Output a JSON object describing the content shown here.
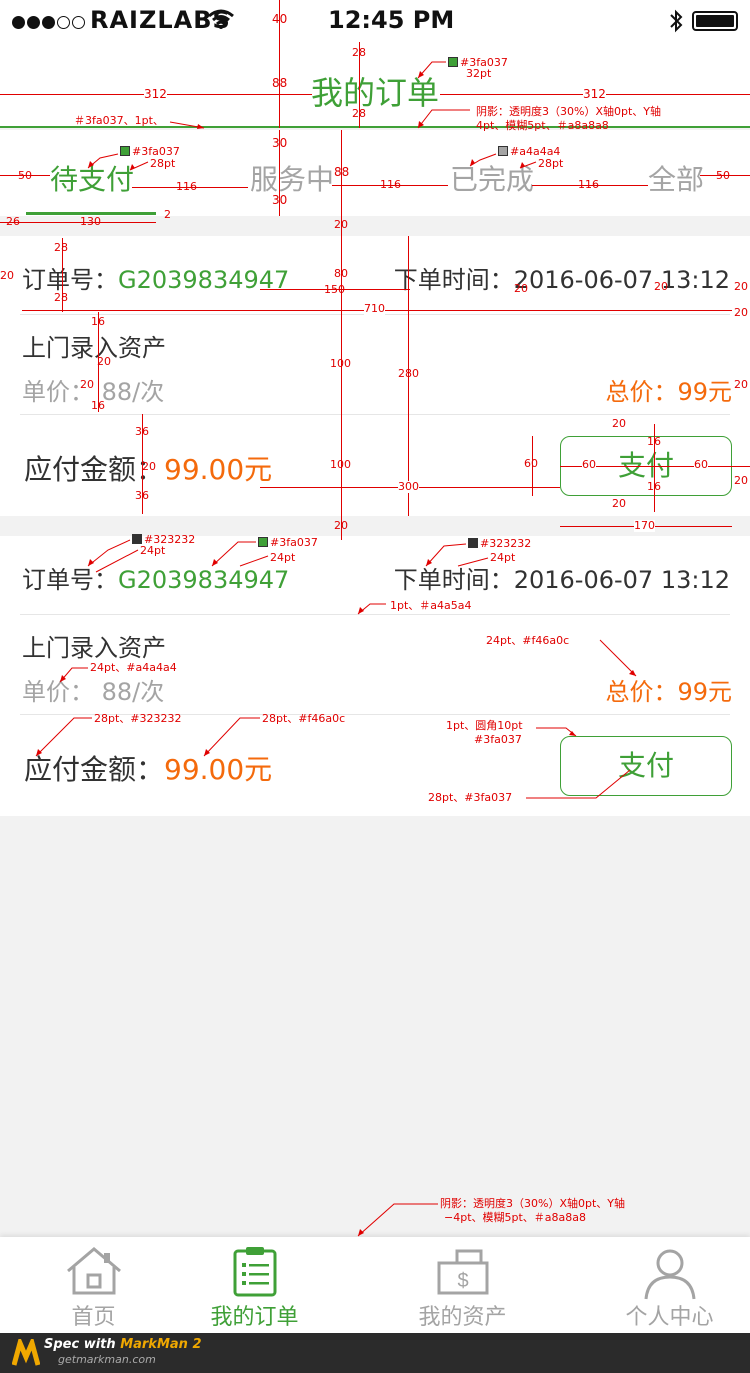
{
  "status_bar": {
    "carrier": "RAIZLABS",
    "time": "12:45 PM"
  },
  "nav": {
    "title": "我的订单"
  },
  "tabs": [
    {
      "label": "待支付",
      "active": true
    },
    {
      "label": "服务中",
      "active": false
    },
    {
      "label": "已完成",
      "active": false
    },
    {
      "label": "全部",
      "active": false
    }
  ],
  "orders": [
    {
      "order_label": "订单号：",
      "order_id": "G2039834947",
      "time_label": "下单时间：",
      "time_value": "2016-06-07  13:12",
      "service": "上门录入资产",
      "unit_price": "单价：  88/次",
      "total": "总价：99元",
      "pay_label": "应付金额：",
      "pay_amount": "99.00元",
      "pay_button": "支付"
    },
    {
      "order_label": "订单号：",
      "order_id": "G2039834947",
      "time_label": "下单时间：",
      "time_value": "2016-06-07  13:12",
      "service": "上门录入资产",
      "unit_price": "单价：  88/次",
      "total": "总价：99元",
      "pay_label": "应付金额：",
      "pay_amount": "99.00元",
      "pay_button": "支付"
    }
  ],
  "tabbar": [
    {
      "label": "首页",
      "icon": "home-icon",
      "active": false
    },
    {
      "label": "我的订单",
      "icon": "order-list-icon",
      "active": true
    },
    {
      "label": "我的资产",
      "icon": "asset-icon",
      "active": false
    },
    {
      "label": "个人中心",
      "icon": "user-icon",
      "active": false
    }
  ],
  "markman": {
    "line1": "Spec with ",
    "brand": "MarkMan 2",
    "line2": "getmarkman.com"
  },
  "colors": {
    "accent_green": "#3fa037",
    "text_dark": "#323232",
    "text_gray": "#a4a4a4",
    "price_orange": "#f46a0c",
    "shadow": "#a8a8a8",
    "annotation_red": "#e00000"
  },
  "annotations": {
    "a28_top": "28",
    "a40": "40",
    "a88_nav": "88",
    "a312_left": "312",
    "a312_right": "312",
    "a28_below": "28",
    "a30_a": "30",
    "a30_b": "30",
    "title_color": "#3fa037",
    "title_size": "32pt",
    "line_color": "＃3fa037、1pt、",
    "shadow_top_1": "阴影：透明度3（30%）X轴0pt、Y轴",
    "shadow_top_2": "4pt、模糊5pt、＃a8a8a8",
    "a50_left": "50",
    "tab_active_color": "#3fa037",
    "tab_active_size": "28pt",
    "a116_1": "116",
    "a88_tabs": "88",
    "a116_2": "116",
    "tab_gray_color": "#a4a4a4",
    "tab_gray_size": "28pt",
    "a116_3": "116",
    "a50_right": "50",
    "a26": "26",
    "a130": "130",
    "a2": "2",
    "a20_gap": "20",
    "a28_card": "28",
    "a20_l": "20",
    "a80": "80",
    "a150": "150",
    "a20_t1": "20",
    "a20_t2": "20",
    "a20_t3": "20",
    "a28_card2": "28",
    "a710": "710",
    "a20_r": "20",
    "a16_a": "16",
    "a100_a": "100",
    "a280": "280",
    "a20_b": "20",
    "a20_c": "20",
    "a16_b": "16",
    "a20_total": "20",
    "a20_btn_top": "20",
    "a36_a": "36",
    "a16_btn": "16",
    "a100_b": "100",
    "a20_d": "20",
    "a60_h": "60",
    "a60_l": "60",
    "a60_r": "60",
    "a20_btn_r": "20",
    "a36_b": "36",
    "a300": "300",
    "a16_btn2": "16",
    "a20_btn_bot": "20",
    "a20_gap2": "20",
    "a170": "170",
    "lbl_dark_color": "#323232",
    "lbl_dark_size": "24pt",
    "id_color": "#3fa037",
    "id_size": "24pt",
    "time_color": "#323232",
    "time_size": "24pt",
    "divider_spec": "1pt、＃a4a5a4",
    "total_spec": "24pt、#f46a0c",
    "price_spec": "24pt、#a4a4a4",
    "paylbl_spec": "28pt、#323232",
    "payamt_spec": "28pt、#f46a0c",
    "btn_spec_1": "1pt、圆角10pt",
    "btn_spec_2": "#3fa037",
    "btn_text_spec": "28pt、#3fa037",
    "shadow_bot_1": "阴影：透明度3（30%）X轴0pt、Y轴",
    "shadow_bot_2": "−4pt、模糊5pt、＃a8a8a8"
  }
}
